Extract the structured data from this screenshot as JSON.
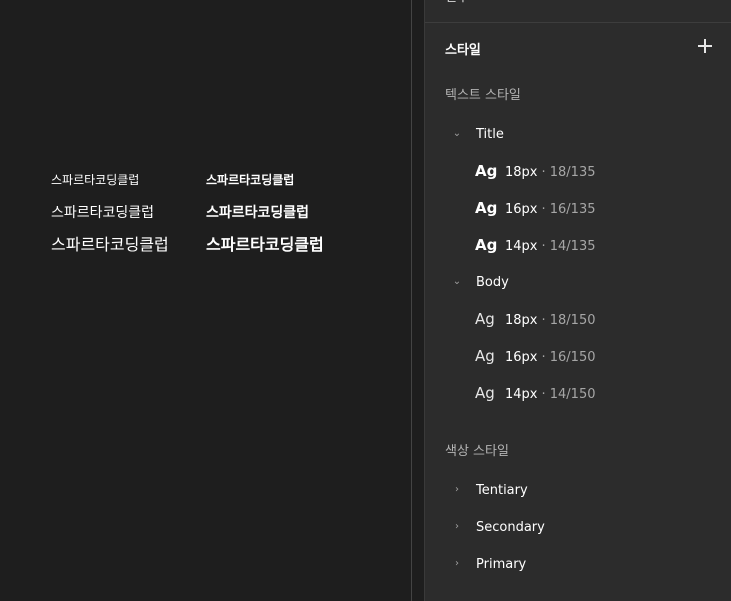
{
  "canvas": {
    "sample_text": "스파르타코딩클럽"
  },
  "panel": {
    "top_cut_label": "변수",
    "top_cut_icon": "↕",
    "section_title": "스타일",
    "text_styles_label": "텍스트 스타일",
    "color_styles_label": "색상 스타일",
    "text_groups": [
      {
        "name": "Title",
        "items": [
          {
            "ag": "Ag",
            "size": "18px",
            "meta": "· 18/135"
          },
          {
            "ag": "Ag",
            "size": "16px",
            "meta": "· 16/135"
          },
          {
            "ag": "Ag",
            "size": "14px",
            "meta": "· 14/135"
          }
        ]
      },
      {
        "name": "Body",
        "items": [
          {
            "ag": "Ag",
            "size": "18px",
            "meta": "· 18/150"
          },
          {
            "ag": "Ag",
            "size": "16px",
            "meta": "· 16/150"
          },
          {
            "ag": "Ag",
            "size": "14px",
            "meta": "· 14/150"
          }
        ]
      }
    ],
    "color_groups": [
      "Tentiary",
      "Secondary",
      "Primary"
    ]
  }
}
